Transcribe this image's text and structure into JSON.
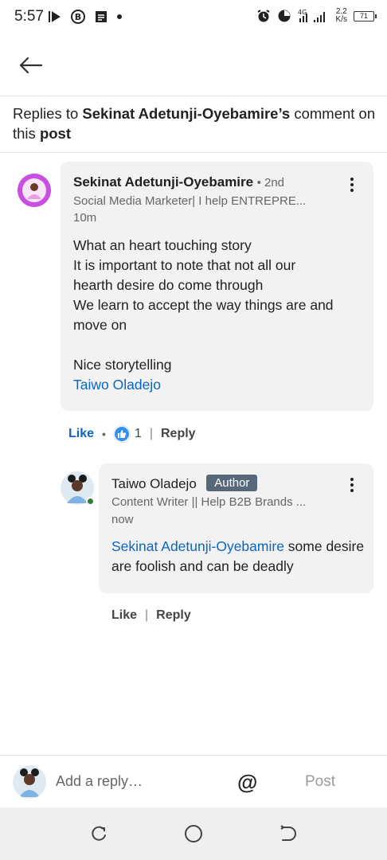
{
  "status_bar": {
    "time": "5:57",
    "network": "4G",
    "speed_top": "2.2",
    "speed_bottom": "K/s",
    "battery": "71",
    "icons": [
      "media-icon",
      "b-badge-icon",
      "message-icon",
      "alarm-icon",
      "timer-icon",
      "signal-icon"
    ]
  },
  "header": {
    "prefix": "Replies to ",
    "author": "Sekinat Adetunji-Oyebamire’s",
    "middle": " comment on this ",
    "post_word": "post"
  },
  "comment": {
    "name": "Sekinat Adetunji-Oyebamire",
    "degree": "• 2nd",
    "headline": "Social Media Marketer| I help ENTREPRE...",
    "time": "10m",
    "body_lines": [
      "What an heart touching story",
      "It is important to note that not all our",
      "hearth desire do come through",
      "We learn to accept the way things are and",
      "move on"
    ],
    "body_end": "Nice storytelling",
    "mention": "Taiwo Oladejo",
    "like_label": "Like",
    "reaction_count": "1",
    "reply_label": "Reply"
  },
  "reply": {
    "name": "Taiwo Oladejo",
    "badge": "Author",
    "headline": "Content Writer || Help B2B Brands ...",
    "time": "now",
    "mention": "Sekinat Adetunji-Oyebamire",
    "text_after_mention": " some desire are foolish and can be deadly",
    "like_label": "Like",
    "reply_label": "Reply"
  },
  "compose": {
    "placeholder": "Add a reply…",
    "at_symbol": "@",
    "post_label": "Post"
  },
  "colors": {
    "link": "#0a66c2",
    "bubble": "#f2f2f2",
    "badge": "#56687a",
    "online": "#2e7d32"
  }
}
